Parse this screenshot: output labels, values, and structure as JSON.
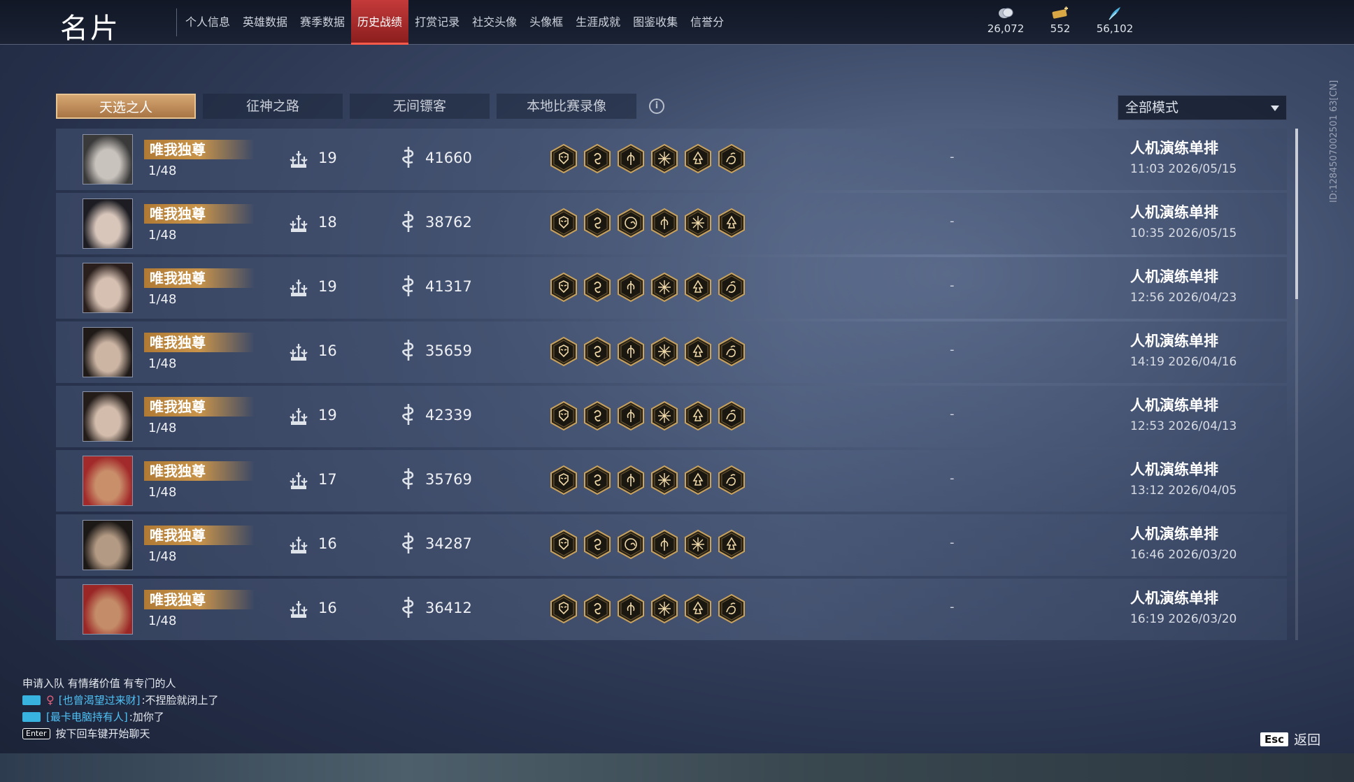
{
  "header": {
    "title": "名片",
    "tabs": [
      {
        "label": "个人信息",
        "active": false,
        "has_dot": true
      },
      {
        "label": "英雄数据",
        "active": false
      },
      {
        "label": "赛季数据",
        "active": false
      },
      {
        "label": "历史战绩",
        "active": true
      },
      {
        "label": "打赏记录",
        "active": false
      },
      {
        "label": "社交头像",
        "active": false
      },
      {
        "label": "头像框",
        "active": false
      },
      {
        "label": "生涯成就",
        "active": false
      },
      {
        "label": "图鉴收集",
        "active": false
      },
      {
        "label": "信誉分",
        "active": false
      }
    ],
    "currencies": [
      {
        "icon": "coin-icon",
        "value": "26,072"
      },
      {
        "icon": "gold-ticket-icon",
        "value": "552"
      },
      {
        "icon": "feather-icon",
        "value": "56,102"
      }
    ]
  },
  "subtabs": [
    {
      "label": "天选之人",
      "active": true
    },
    {
      "label": "征神之路",
      "active": false
    },
    {
      "label": "无间镖客",
      "active": false
    },
    {
      "label": "本地比赛录像",
      "active": false
    }
  ],
  "mode_select": {
    "value": "全部模式"
  },
  "matches": [
    {
      "rank": "唯我独尊",
      "placement": "1/48",
      "kills": "19",
      "score": "41660",
      "talents": [
        "demon-mask-icon",
        "swirl-icon",
        "vine-icon",
        "burst-icon",
        "flame-icon",
        "wave-icon"
      ],
      "result": "-",
      "mode": "人机演练单排",
      "time": "11:03  2026/05/15"
    },
    {
      "rank": "唯我独尊",
      "placement": "1/48",
      "kills": "18",
      "score": "38762",
      "talents": [
        "demon-mask-icon",
        "swirl-icon",
        "spiral-icon",
        "vine-icon",
        "burst-icon",
        "flame-icon"
      ],
      "result": "-",
      "mode": "人机演练单排",
      "time": "10:35  2026/05/15"
    },
    {
      "rank": "唯我独尊",
      "placement": "1/48",
      "kills": "19",
      "score": "41317",
      "talents": [
        "demon-mask-icon",
        "swirl-icon",
        "vine-icon",
        "burst-icon",
        "flame-icon",
        "wave-icon"
      ],
      "result": "-",
      "mode": "人机演练单排",
      "time": "12:56  2026/04/23"
    },
    {
      "rank": "唯我独尊",
      "placement": "1/48",
      "kills": "16",
      "score": "35659",
      "talents": [
        "demon-mask-icon",
        "swirl-icon",
        "vine-icon",
        "burst-icon",
        "flame-icon",
        "wave-icon"
      ],
      "result": "-",
      "mode": "人机演练单排",
      "time": "14:19  2026/04/16"
    },
    {
      "rank": "唯我独尊",
      "placement": "1/48",
      "kills": "19",
      "score": "42339",
      "talents": [
        "demon-mask-icon",
        "swirl-icon",
        "vine-icon",
        "burst-icon",
        "flame-icon",
        "wave-icon"
      ],
      "result": "-",
      "mode": "人机演练单排",
      "time": "12:53  2026/04/13"
    },
    {
      "rank": "唯我独尊",
      "placement": "1/48",
      "kills": "17",
      "score": "35769",
      "talents": [
        "demon-mask-icon",
        "swirl-icon",
        "vine-icon",
        "burst-icon",
        "flame-icon",
        "wave-icon"
      ],
      "result": "-",
      "mode": "人机演练单排",
      "time": "13:12  2026/04/05"
    },
    {
      "rank": "唯我独尊",
      "placement": "1/48",
      "kills": "16",
      "score": "34287",
      "talents": [
        "demon-mask-icon",
        "swirl-icon",
        "spiral-icon",
        "vine-icon",
        "burst-icon",
        "flame-icon"
      ],
      "result": "-",
      "mode": "人机演练单排",
      "time": "16:46  2026/03/20"
    },
    {
      "rank": "唯我独尊",
      "placement": "1/48",
      "kills": "16",
      "score": "36412",
      "talents": [
        "demon-mask-icon",
        "swirl-icon",
        "vine-icon",
        "burst-icon",
        "flame-icon",
        "wave-icon"
      ],
      "result": "-",
      "mode": "人机演练单排",
      "time": "16:19  2026/03/20"
    }
  ],
  "side_id": "ID:1284507002501 63[CN]",
  "chat": {
    "line1": "申请入队  有情绪价值 有专门的人",
    "line2_name": "[也曾渴望过来财]",
    "line2_text": ":不捏脸就闭上了",
    "line3_name": "[最卡电脑持有人]",
    "line3_text": ":加你了",
    "enter_key": "Enter",
    "hint": "按下回车键开始聊天"
  },
  "footer": {
    "esc_key": "Esc",
    "back_label": "返回"
  },
  "colors": {
    "accent_red": "#c43a3a",
    "gold": "#c9944a",
    "chat_name": "#4fc3f7"
  }
}
